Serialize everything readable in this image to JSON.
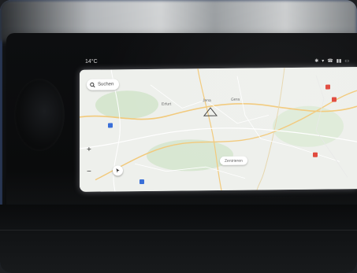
{
  "status_bar": {
    "temperature": "14°C",
    "icons": [
      "bluetooth-icon",
      "wifi-icon",
      "phone-icon",
      "signal-icon",
      "battery-icon"
    ]
  },
  "map": {
    "search": {
      "label": "Suchen",
      "icon": "search-icon"
    },
    "place_labels": [
      "Erfurt",
      "Jena",
      "Gera"
    ],
    "destination_label": "Zentrieren",
    "zoom_in_label": "+",
    "zoom_out_label": "−",
    "locate_icon": "navigation-arrow-icon",
    "colors": {
      "land": "#eef0ec",
      "road": "#f2c97a",
      "forest": "#cfe3c8",
      "marker": "#e0473b",
      "highway_badge": "#3a6fd8"
    }
  }
}
